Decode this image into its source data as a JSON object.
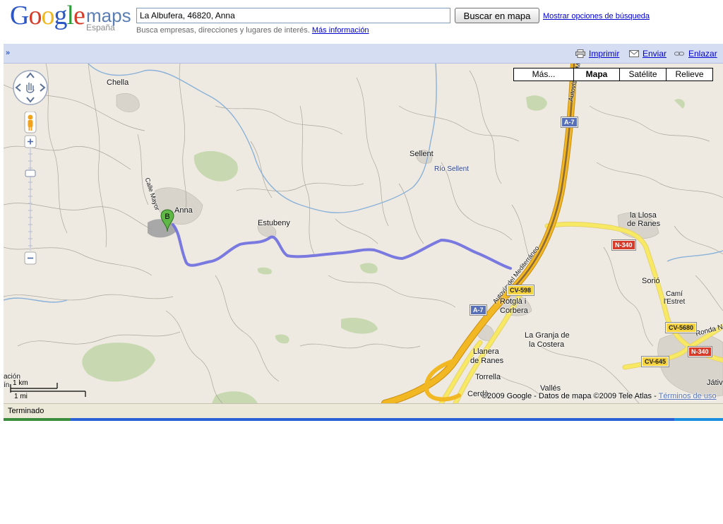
{
  "header": {
    "logo": {
      "brand": "Google",
      "product": "maps",
      "country": "España"
    },
    "search": {
      "value": "La Albufera, 46820, Anna",
      "button_label": "Buscar en mapa"
    },
    "options_link": "Mostrar opciones de búsqueda",
    "hint": {
      "text": "Busca empresas, direcciones y lugares de interés.",
      "link": "Más información"
    }
  },
  "toolbar": {
    "collapse_label": "»",
    "actions": [
      {
        "label": "Imprimir",
        "icon": "printer-icon"
      },
      {
        "label": "Enviar",
        "icon": "envelope-icon"
      },
      {
        "label": "Enlazar",
        "icon": "link-icon"
      }
    ]
  },
  "map": {
    "map_types": [
      {
        "label": "Más...",
        "active": false
      },
      {
        "label": "Mapa",
        "active": true
      },
      {
        "label": "Satélite",
        "active": false
      },
      {
        "label": "Relieve",
        "active": false
      }
    ],
    "marker": {
      "label": "B"
    },
    "places": {
      "chella": "Chella",
      "anna": "Anna",
      "calle_mayor": "Calle Mayor",
      "estubeny": "Estubeny",
      "sellent": "Sellent",
      "rio_sellent": "Río Sellent",
      "la_llosa": "la Llosa",
      "de_ranes": "de Ranes",
      "sorio": "Sorió",
      "cami": "Camí",
      "l_estret": "l'Estret",
      "rotgla": "Rotglà i",
      "corbera": "Corbera",
      "la_granja": "La Granja de",
      "la_costera": "la Costera",
      "llanera": "Llanera",
      "de_ranes2": "de Ranes",
      "torrella": "Torrella",
      "valles": "Vallés",
      "cerda": "Cerdà",
      "jativa": "Játiv",
      "ronda": "Ronda No",
      "autovia": "Autovía del Mediterráneo",
      "autovia_top": "Autovía del M",
      "edge_top": "ación",
      "edge_bottom": "ín"
    },
    "shields": {
      "a7_top": "A-7",
      "a7_bottom": "A-7",
      "n340_a": "N-340",
      "n340_b": "N-340",
      "cv598": "CV-598",
      "cv5680": "CV-5680",
      "cv645": "CV-645"
    },
    "scale": {
      "km": "1 km",
      "mi": "1 mi"
    },
    "copyright": {
      "text": "©2009 Google - Datos de mapa ©2009 Tele Atlas -",
      "link": "Términos de uso"
    }
  },
  "status": {
    "text": "Terminado"
  },
  "colors": {
    "route": "#6b6de0",
    "highway": "#f2b824",
    "road_yellow": "#f8e964",
    "river": "#8ab1d9"
  }
}
